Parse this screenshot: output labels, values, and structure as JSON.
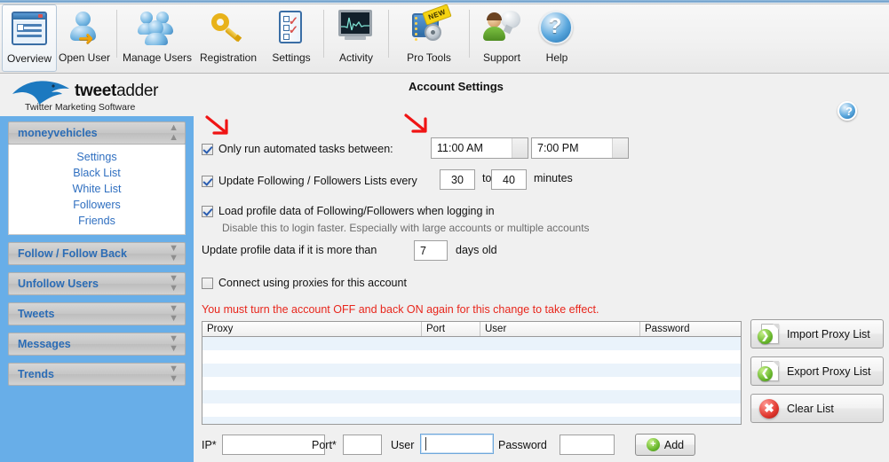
{
  "toolbar": {
    "items": [
      {
        "label": "Overview",
        "icon": "overview-icon",
        "selected": true
      },
      {
        "label": "Open User",
        "icon": "open-user-icon",
        "selected": false
      },
      {
        "label": "Manage Users",
        "icon": "manage-users-icon",
        "selected": false
      },
      {
        "label": "Registration",
        "icon": "key-icon",
        "selected": false
      },
      {
        "label": "Settings",
        "icon": "settings-checklist-icon",
        "selected": false
      },
      {
        "label": "Activity",
        "icon": "activity-monitor-icon",
        "selected": false
      },
      {
        "label": "Pro Tools",
        "icon": "pro-tools-icon",
        "badge": "NEW",
        "selected": false
      },
      {
        "label": "Support",
        "icon": "support-person-icon",
        "selected": false
      },
      {
        "label": "Help",
        "icon": "help-question-icon",
        "selected": false
      }
    ]
  },
  "logo": {
    "word_bold": "tweet",
    "word_light": "adder",
    "tagline": "Twitter Marketing Software"
  },
  "sidebar": {
    "panels": [
      {
        "title": "moneyvehicles",
        "expanded": true,
        "chevron": "chevron-up",
        "links": [
          "Settings",
          "Black List",
          "White List",
          "Followers",
          "Friends"
        ]
      },
      {
        "title": "Follow / Follow Back",
        "expanded": false,
        "chevron": "chevron-down",
        "links": []
      },
      {
        "title": "Unfollow Users",
        "expanded": false,
        "chevron": "chevron-down",
        "links": []
      },
      {
        "title": "Tweets",
        "expanded": false,
        "chevron": "chevron-down",
        "links": []
      },
      {
        "title": "Messages",
        "expanded": false,
        "chevron": "chevron-down",
        "links": []
      },
      {
        "title": "Trends",
        "expanded": false,
        "chevron": "chevron-down",
        "links": []
      }
    ]
  },
  "main": {
    "page_title": "Account Settings",
    "help_glyph": "?",
    "schedule": {
      "checkbox_checked": true,
      "label": "Only run automated tasks between:",
      "start_time": "11:00 AM",
      "end_time": "7:00 PM"
    },
    "update_lists": {
      "checkbox_checked": true,
      "label": "Update Following / Followers Lists every",
      "min_minutes": "30",
      "to_label": "to",
      "max_minutes": "40",
      "unit_label": "minutes"
    },
    "load_profile": {
      "checkbox_checked": true,
      "label": "Load profile data of Following/Followers when logging in",
      "sublabel": "Disable this to login faster.  Especially with large accounts or multiple accounts"
    },
    "profile_age": {
      "label": "Update profile data if it is more than",
      "days": "7",
      "unit_label": "days old"
    },
    "proxies": {
      "checkbox_checked": false,
      "label": "Connect using proxies for this account",
      "warning": "You must turn the account OFF and back ON again for this change to take effect.",
      "columns": [
        "Proxy",
        "Port",
        "User",
        "Password"
      ],
      "rows": [],
      "empty_row_count": 7,
      "buttons": [
        {
          "label": "Import Proxy List",
          "icon": "import-page-icon"
        },
        {
          "label": "Export Proxy List",
          "icon": "export-page-icon"
        },
        {
          "label": "Clear List",
          "icon": "red-x-icon"
        }
      ]
    },
    "add_proxy_form": {
      "ip_label": "IP*",
      "ip_value": "",
      "port_label": "Port*",
      "port_value": "",
      "user_label": "User",
      "user_value": "",
      "user_focused": true,
      "password_label": "Password",
      "password_value": "",
      "add_label": "Add"
    }
  },
  "annotations": {
    "arrow_color": "#f01414",
    "marks": [
      "arrow-pointing-to-schedule-checkbox",
      "arrow-pointing-to-start-time-field"
    ]
  },
  "colors": {
    "sidebar_bg": "#68aee8",
    "link": "#2f6fc0",
    "panel_title": "#2b6cb5",
    "warning": "#e8261c",
    "content_bg": "#f0f0f0"
  }
}
